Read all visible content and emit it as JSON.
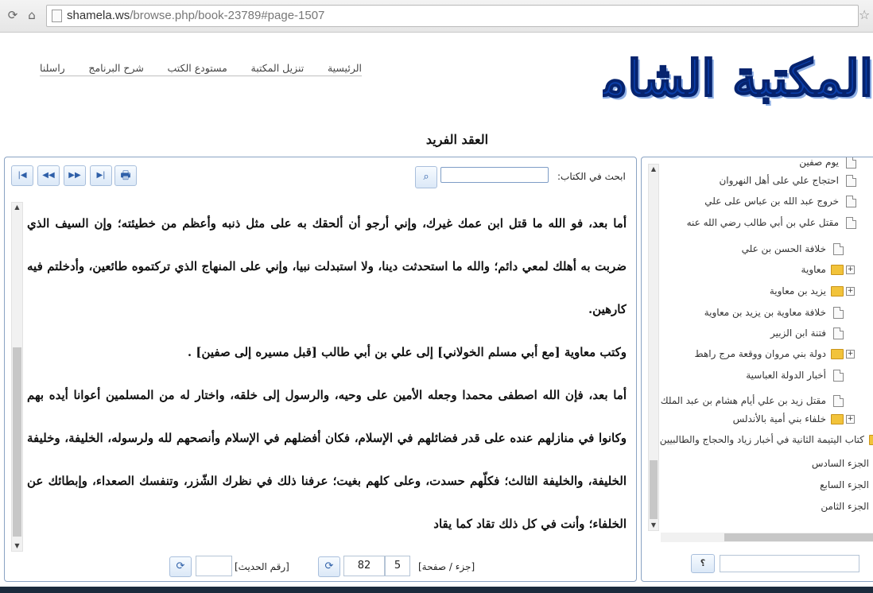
{
  "browser": {
    "url_domain": "shamela.ws",
    "url_path": "/browse.php/book-23789#page-1507"
  },
  "site": {
    "logo_text": "المكتبة الشاملة",
    "nav": [
      "الرئيسية",
      "تنزيل المكتبة",
      "مستودع الكتب",
      "شرح البرنامج",
      "راسلنا"
    ]
  },
  "book": {
    "title": "العقد الفريد"
  },
  "reader": {
    "search_label": "ابحث في الكتاب:",
    "search_value": "",
    "paragraphs": [
      "أما بعد، فو الله ما قتل ابن عمك غيرك، وإني أرجو أن ألحقك به على مثل ذنبه وأعظم من خطيئته؛ وإن السيف الذي ضربت به أهلك لمعي دائم؛ والله ما استحدثت دينا، ولا استبدلت نبيا، وإني على المنهاج الذي تركتموه طائعين، وأدخلتم فيه كارهين.",
      "وكتب معاوية [مع أبي مسلم الخولاني] إلى علي بن أبي طالب [قبل مسيره إلى صفين] .",
      "أما بعد، فإن الله اصطفى محمدا وجعله الأمين على وحيه، والرسول إلى خلقه، واختار له من المسلمين أعوانا أيده بهم وكانوا في منازلهم عنده على قدر فضائلهم في الإسلام، فكان أفضلهم في الإسلام وأنصحهم لله ولرسوله، الخليفة، وخليفة الخليفة، والخليفة الثالث؛ فكلّهم حسدت، وعلى كلهم بغيت؛ عرفنا ذلك في نظرك الشّزر، وتنفسك الصعداء، وإبطائك عن الخلفاء؛ وأنت في كل ذلك تقاد كما يقاد"
    ],
    "footer": {
      "part_page_label": "[جزء / صفحة]",
      "part": "5",
      "page": "82",
      "hadith_label": "[رقم الحديث]",
      "hadith_value": ""
    }
  },
  "tree": {
    "items": [
      {
        "label": "يوم صفين",
        "type": "doc"
      },
      {
        "label": "احتجاج علي على أهل النهروان",
        "type": "doc"
      },
      {
        "label": "خروج عبد الله بن عباس على علي",
        "type": "doc"
      },
      {
        "label": "مقتل علي بن أبي طالب رضي الله عنه",
        "type": "doc"
      },
      {
        "label": "خلافة الحسن بن علي",
        "type": "doc"
      },
      {
        "label": "معاوية",
        "type": "folder"
      },
      {
        "label": "يزيد بن معاوية",
        "type": "folder"
      },
      {
        "label": "خلافة معاوية بن يزيد بن معاوية",
        "type": "doc"
      },
      {
        "label": "فتنة ابن الزبير",
        "type": "doc"
      },
      {
        "label": "دولة بني مروان ووقعة مرج راهط",
        "type": "folder"
      },
      {
        "label": "أخبار الدولة العباسية",
        "type": "doc"
      },
      {
        "label": "مقتل زيد بن علي أيام هشام بن عبد الملك",
        "type": "doc"
      },
      {
        "label": "خلفاء بني أمية بالأندلس",
        "type": "folder"
      },
      {
        "label": "كتاب اليتيمة الثانية في أخبار زياد والحجاج والطالبيين",
        "type": "folder"
      },
      {
        "label": "الجزء السادس",
        "type": "plain"
      },
      {
        "label": "الجزء السابع",
        "type": "plain"
      },
      {
        "label": "الجزء الثامن",
        "type": "plain"
      }
    ],
    "help_label": "؟",
    "search_value": ""
  }
}
